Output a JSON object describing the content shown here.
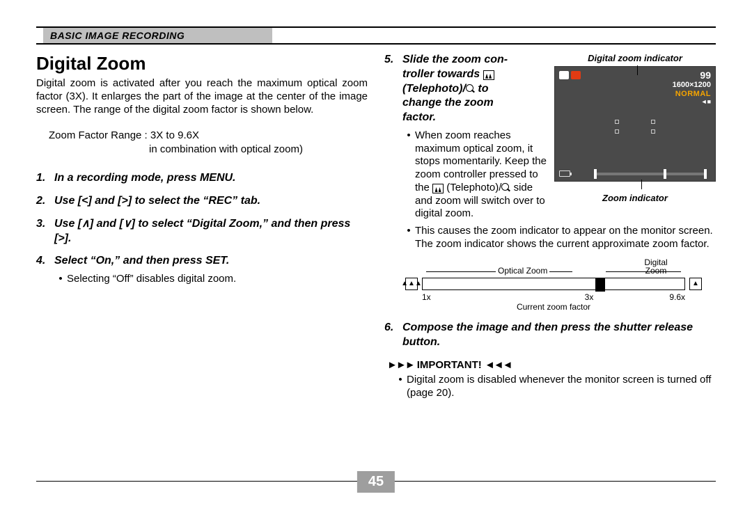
{
  "header": {
    "section": "BASIC IMAGE RECORDING"
  },
  "left": {
    "title": "Digital Zoom",
    "intro": "Digital zoom is activated after you reach the maximum optical zoom factor (3X). It enlarges the part of the image at the center of the image screen. The range of the digital zoom factor is shown below.",
    "range": {
      "label": "Zoom Factor Range",
      "value": "3X to 9.6X",
      "sub": "in combination with optical zoom)"
    },
    "steps": {
      "s1": {
        "n": "1.",
        "t": "In a recording mode, press MENU."
      },
      "s2": {
        "n": "2.",
        "t_a": "Use [",
        "t_b": "] and [",
        "t_c": "] to select the “REC” tab."
      },
      "s3": {
        "n": "3.",
        "t_a": "Use [",
        "t_b": "] and [",
        "t_c": "] to select “Digital Zoom,” and then press [",
        "t_d": "]."
      },
      "s4": {
        "n": "4.",
        "t": "Select “On,” and then press SET.",
        "bullet": "Selecting “Off” disables digital zoom."
      }
    }
  },
  "right": {
    "step5": {
      "n": "5.",
      "line1": "Slide the zoom con-",
      "line2": "troller towards ",
      "line3a": "(Telephoto)/",
      "line3b": " to",
      "line4": "change the zoom",
      "line5": "factor.",
      "bullet1_a": "When zoom reaches maximum optical zoom, it stops momentarily. Keep the zoom controller pressed to the ",
      "bullet1_b": " (Telephoto)/",
      "bullet1_c": " side and zoom will switch over to digital zoom.",
      "bullet2": "This causes the zoom indicator to appear on the monitor screen. The zoom indicator shows the current approximate zoom factor."
    },
    "screen": {
      "dz_indicator_label": "Digital zoom indicator",
      "zoom_indicator_label": "Zoom indicator",
      "shots": "99",
      "res": "1600×1200",
      "quality": "NORMAL"
    },
    "diagram": {
      "optical": "Optical Zoom",
      "digital_l1": "Digital",
      "digital_l2": "Zoom",
      "x1": "1x",
      "x3": "3x",
      "x96": "9.6x",
      "current": "Current zoom factor"
    },
    "step6": {
      "n": "6.",
      "t": "Compose the image and then press the shutter release button."
    },
    "important": {
      "hd": "IMPORTANT!",
      "bullet": "Digital zoom is disabled whenever the monitor screen is turned off (page 20)."
    }
  },
  "page": "45"
}
